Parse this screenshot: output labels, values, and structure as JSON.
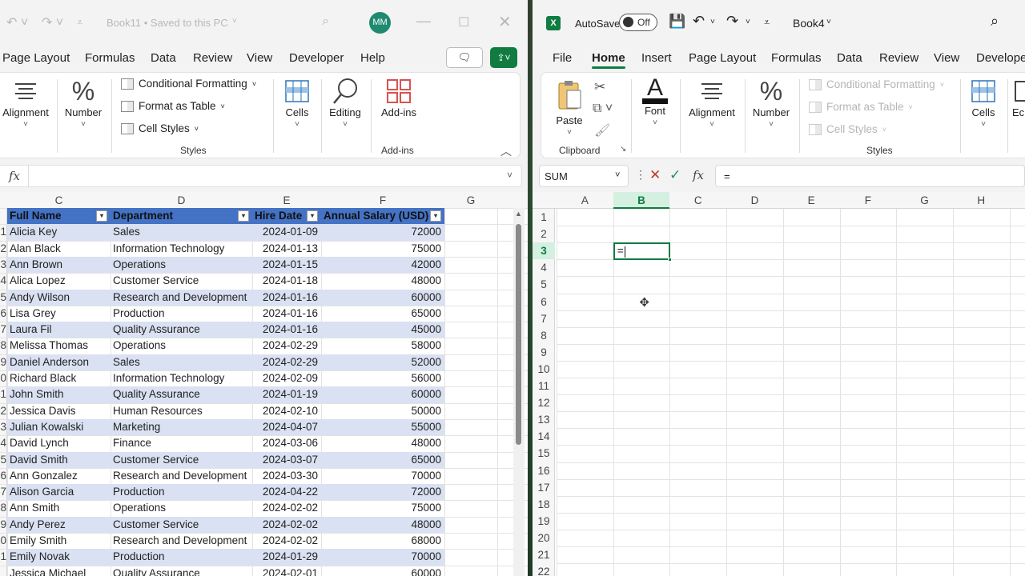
{
  "left_window": {
    "title": "Book11 • Saved to this PC",
    "avatar_initials": "MM",
    "tabs": [
      "Page Layout",
      "Formulas",
      "Data",
      "Review",
      "View",
      "Developer",
      "Help"
    ],
    "ribbon": {
      "alignment": "Alignment",
      "number": "Number",
      "conditional_formatting": "Conditional Formatting",
      "format_as_table": "Format as Table",
      "cell_styles": "Cell Styles",
      "styles_group": "Styles",
      "cells": "Cells",
      "editing": "Editing",
      "addins": "Add-ins",
      "addins_group": "Add-ins"
    },
    "formula_value": "",
    "columns": [
      "C",
      "D",
      "E",
      "F",
      "G"
    ],
    "table_headers": [
      "Full Name",
      "Department",
      "Hire Date",
      "Annual Salary (USD)"
    ],
    "row_ids": [
      "1",
      "2",
      "3",
      "4",
      "5",
      "6",
      "7",
      "8",
      "9",
      "0",
      "1",
      "2",
      "3",
      "4",
      "5",
      "6",
      "7",
      "8",
      "9",
      "0",
      "1",
      ""
    ],
    "rows": [
      [
        "Alicia Key",
        "Sales",
        "2024-01-09",
        "72000"
      ],
      [
        "Alan Black",
        "Information Technology",
        "2024-01-13",
        "75000"
      ],
      [
        "Ann Brown",
        "Operations",
        "2024-01-15",
        "42000"
      ],
      [
        "Alica Lopez",
        "Customer Service",
        "2024-01-18",
        "48000"
      ],
      [
        "Andy Wilson",
        "Research and Development",
        "2024-01-16",
        "60000"
      ],
      [
        "Lisa Grey",
        "Production",
        "2024-01-16",
        "65000"
      ],
      [
        "Laura Fil",
        "Quality Assurance",
        "2024-01-16",
        "45000"
      ],
      [
        "Melissa Thomas",
        "Operations",
        "2024-02-29",
        "58000"
      ],
      [
        "Daniel Anderson",
        "Sales",
        "2024-02-29",
        "52000"
      ],
      [
        "Richard Black",
        "Information Technology",
        "2024-02-09",
        "56000"
      ],
      [
        "John Smith",
        "Quality Assurance",
        "2024-01-19",
        "60000"
      ],
      [
        "Jessica Davis",
        "Human Resources",
        "2024-02-10",
        "50000"
      ],
      [
        "Julian Kowalski",
        "Marketing",
        "2024-04-07",
        "55000"
      ],
      [
        "David Lynch",
        "Finance",
        "2024-03-06",
        "48000"
      ],
      [
        "David Smith",
        "Customer Service",
        "2024-03-07",
        "65000"
      ],
      [
        "Ann Gonzalez",
        "Research and Development",
        "2024-03-30",
        "70000"
      ],
      [
        "Alison Garcia",
        "Production",
        "2024-04-22",
        "72000"
      ],
      [
        "Ann Smith",
        "Operations",
        "2024-02-02",
        "75000"
      ],
      [
        "Andy Perez",
        "Customer Service",
        "2024-02-02",
        "48000"
      ],
      [
        "Emily Smith",
        "Research and Development",
        "2024-02-02",
        "68000"
      ],
      [
        "Emily Novak",
        "Production",
        "2024-01-29",
        "70000"
      ],
      [
        "Jessica Michael",
        "Quality Assurance",
        "2024-02-01",
        "60000"
      ]
    ]
  },
  "right_window": {
    "autosave_label": "AutoSave",
    "autosave_state": "Off",
    "title": "Book4",
    "tabs": [
      "File",
      "Home",
      "Insert",
      "Page Layout",
      "Formulas",
      "Data",
      "Review",
      "View",
      "Develope"
    ],
    "active_tab": "Home",
    "ribbon": {
      "paste": "Paste",
      "clipboard_group": "Clipboard",
      "font": "Font",
      "alignment": "Alignment",
      "number": "Number",
      "conditional_formatting": "Conditional Formatting",
      "format_as_table": "Format as Table",
      "cell_styles": "Cell Styles",
      "styles_group": "Styles",
      "cells": "Cells",
      "next": "Ec"
    },
    "name_box": "SUM",
    "formula_value": "=",
    "columns": [
      "A",
      "B",
      "C",
      "D",
      "E",
      "F",
      "G",
      "H"
    ],
    "rows": [
      "1",
      "2",
      "3",
      "4",
      "5",
      "6",
      "7",
      "8",
      "9",
      "10",
      "11",
      "12",
      "13",
      "14",
      "15",
      "16",
      "17",
      "18",
      "19",
      "20",
      "21",
      "22"
    ],
    "active_cell_value": "=",
    "active_cell_ref": "B3"
  },
  "colors": {
    "accent": "#107c41",
    "table_header": "#4472c4",
    "band": "#d9e1f2"
  }
}
